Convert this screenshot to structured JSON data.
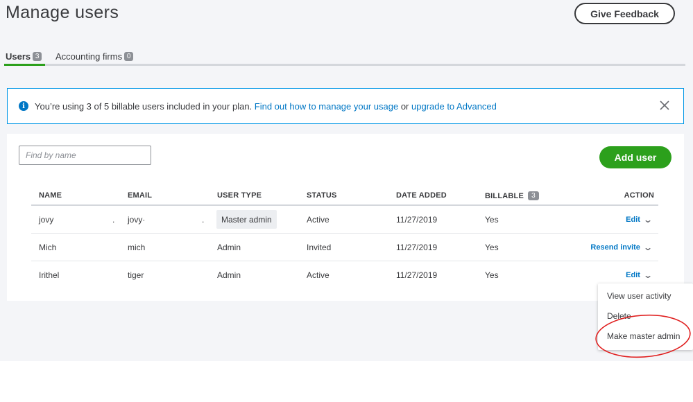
{
  "page": {
    "title": "Manage users",
    "feedback_label": "Give Feedback"
  },
  "tabs": [
    {
      "label": "Users",
      "count": "3",
      "active": true
    },
    {
      "label": "Accounting firms",
      "count": "0",
      "active": false
    }
  ],
  "banner": {
    "text": "You’re using 3 of 5 billable users included in your plan. ",
    "link1": "Find out how to manage your usage",
    "between": " or ",
    "link2": "upgrade to Advanced"
  },
  "toolbar": {
    "search_placeholder": "Find by name",
    "add_user_label": "Add user"
  },
  "table": {
    "headers": {
      "name": "NAME",
      "email": "EMAIL",
      "user_type": "USER TYPE",
      "status": "STATUS",
      "date_added": "DATE ADDED",
      "billable": "BILLABLE",
      "billable_count": "3",
      "action": "ACTION"
    },
    "rows": [
      {
        "name": "jovy",
        "name_extra": ".",
        "email": "jovy·",
        "email_extra": ".",
        "user_type": "Master admin",
        "status": "Active",
        "date_added": "11/27/2019",
        "billable": "Yes",
        "action": "Edit"
      },
      {
        "name": "Mich",
        "name_extra": "",
        "email": "mich",
        "email_extra": "",
        "user_type": "Admin",
        "status": "Invited",
        "date_added": "11/27/2019",
        "billable": "Yes",
        "action": "Resend invite"
      },
      {
        "name": "Irithel",
        "name_extra": "",
        "email": "tiger",
        "email_extra": "",
        "user_type": "Admin",
        "status": "Active",
        "date_added": "11/27/2019",
        "billable": "Yes",
        "action": "Edit"
      }
    ]
  },
  "menu": {
    "items": [
      "View user activity",
      "Delete",
      "Make master admin"
    ]
  },
  "colors": {
    "accent_green": "#2ca01c",
    "link_blue": "#0077c5",
    "highlight_red": "#e02020"
  }
}
